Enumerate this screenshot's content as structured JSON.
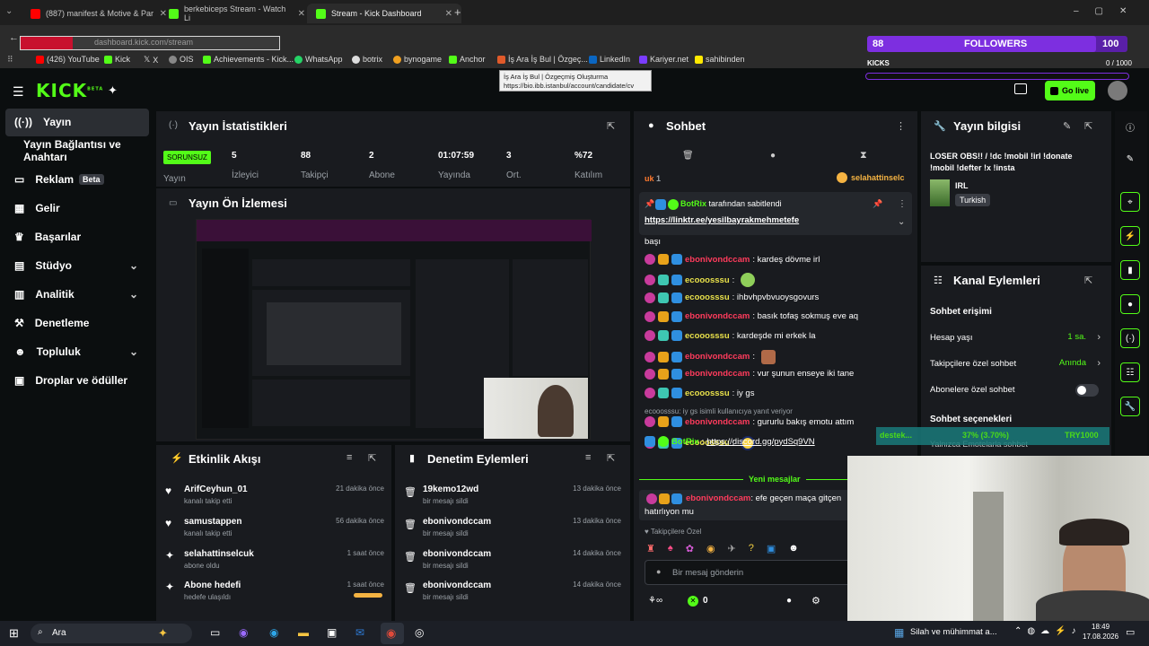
{
  "tabs": [
    {
      "label": "(887) manifest & Motive & Par",
      "icon": "youtube-icon",
      "color": "#ff0000"
    },
    {
      "label": "berkebiceps Stream - Watch Li",
      "icon": "kick-icon",
      "color": "#53fc18"
    },
    {
      "label": "Stream - Kick Dashboard",
      "icon": "kick-icon",
      "color": "#53fc18"
    }
  ],
  "new_tab": "+",
  "address": "dashboard.kick.com/stream",
  "bookmarks": [
    "(426) YouTube",
    "Kick",
    "X",
    "OIS",
    "Achievements - Kick...",
    "WhatsApp",
    "botrix",
    "bynogame",
    "Anchor",
    "İş Ara İş Bul | Özgeç...",
    "LinkedIn",
    "Kariyer.net",
    "sahibinden"
  ],
  "tooltip": {
    "title": "İş Ara İş Bul | Özgeçmiş Oluşturma",
    "url": "https://bio.ibb.istanbul/account/candidate/cv"
  },
  "overlay": {
    "followers_count": "88",
    "followers_label": "FOLLOWERS",
    "goal": "100",
    "kicks_label": "KICKS",
    "kicks_value": "0 / 1000",
    "followers_progress": 0.88
  },
  "topbar": {
    "logo": "KICK",
    "logo_sup": "BETA",
    "golive": "Go live"
  },
  "sidebar": [
    {
      "label": "Yayın",
      "icon": "broadcast-icon",
      "active": true
    },
    {
      "label": "Yayın Bağlantısı ve Anahtarı",
      "icon": ""
    },
    {
      "label": "Reklam",
      "icon": "ad-icon",
      "badge": "Beta"
    },
    {
      "label": "Gelir",
      "icon": "revenue-icon"
    },
    {
      "label": "Başarılar",
      "icon": "trophy-icon"
    },
    {
      "label": "Stüdyo",
      "icon": "studio-icon",
      "chev": "⌄"
    },
    {
      "label": "Analitik",
      "icon": "analytics-icon",
      "chev": "⌄"
    },
    {
      "label": "Denetleme",
      "icon": "moderation-icon"
    },
    {
      "label": "Topluluk",
      "icon": "community-icon",
      "chev": "⌄"
    },
    {
      "label": "Droplar ve ödüller",
      "icon": "drops-icon"
    }
  ],
  "stats": {
    "title": "Yayın İstatistikleri",
    "status": "SORUNSUZ",
    "status_label": "Yayın",
    "items": [
      {
        "value": "5",
        "label": "İzleyici"
      },
      {
        "value": "88",
        "label": "Takipçi"
      },
      {
        "value": "2",
        "label": "Abone"
      },
      {
        "value": "01:07:59",
        "label": "Yayında"
      },
      {
        "value": "3",
        "label": "Ort."
      },
      {
        "value": "%72",
        "label": "Katılım"
      }
    ]
  },
  "preview": {
    "title": "Yayın Ön İzlemesi"
  },
  "activity": {
    "title": "Etkinlik Akışı",
    "items": [
      {
        "name": "ArifCeyhun_01",
        "sub": "kanalı takip etti",
        "time": "21 dakika önce",
        "icon": "heart-icon"
      },
      {
        "name": "samustappen",
        "sub": "kanalı takip etti",
        "time": "56 dakika önce",
        "icon": "heart-icon"
      },
      {
        "name": "selahattinselcuk",
        "sub": "abone oldu",
        "time": "1 saat önce",
        "icon": "star-icon"
      },
      {
        "name": "Abone hedefi",
        "sub": "hedefe ulaşıldı",
        "time": "1 saat önce",
        "icon": "star-icon"
      }
    ]
  },
  "moderation": {
    "title": "Denetim Eylemleri",
    "items": [
      {
        "name": "19kemo12wd",
        "sub": "bir mesajı sildi",
        "time": "13 dakika önce"
      },
      {
        "name": "ebonivondccam",
        "sub": "bir mesajı sildi",
        "time": "13 dakika önce"
      },
      {
        "name": "ebonivondccam",
        "sub": "bir mesajı sildi",
        "time": "14 dakika önce"
      },
      {
        "name": "ebonivondccam",
        "sub": "bir mesajı sildi",
        "time": "14 dakika önce"
      }
    ]
  },
  "chat": {
    "title": "Sohbet",
    "sub_prefix": "uk",
    "sub_count": "1",
    "sub_user": "selahattinselc",
    "pinned_by": "BotRix",
    "pinned_text": "tarafından sabitlendi",
    "pinned_link": "https://linktr.ee/yesilbayrakmehmetefe",
    "partial": "başı",
    "messages": [
      {
        "user": "ebonivondccam",
        "text": ": kardeş dövme irl",
        "color": "#ff3b5c",
        "badges": [
          "bp",
          "bo",
          "bb"
        ]
      },
      {
        "user": "ecooosssu",
        "text": ":",
        "color": "#e8e04a",
        "badges": [
          "bp",
          "bg",
          "bb"
        ],
        "emote": "turtle-emote"
      },
      {
        "user": "ecooosssu",
        "text": ": ihbvhpvbvuoysgovurs",
        "color": "#e8e04a",
        "badges": [
          "bp",
          "bg",
          "bb"
        ]
      },
      {
        "user": "ebonivondccam",
        "text": ": basık tofaş sokmuş eve aq",
        "color": "#ff3b5c",
        "badges": [
          "bp",
          "bo",
          "bb"
        ]
      },
      {
        "user": "ecooosssu",
        "text": ": kardeşde mi erkek la",
        "color": "#e8e04a",
        "badges": [
          "bp",
          "bg",
          "bb"
        ]
      },
      {
        "user": "ebonivondccam",
        "text": ":",
        "color": "#ff3b5c",
        "badges": [
          "bp",
          "bo",
          "bb"
        ],
        "emote": "face-emote"
      },
      {
        "user": "ebonivondccam",
        "text": ": vur şunun enseye iki tane",
        "color": "#ff3b5c",
        "badges": [
          "bp",
          "bo",
          "bb"
        ]
      },
      {
        "user": "ecooosssu",
        "text": ": iy gs",
        "color": "#e8e04a",
        "badges": [
          "bp",
          "bg",
          "bb"
        ]
      }
    ],
    "reply_hint": "ecooosssu: iy gs isimli kullanıcıya yanıt veriyor",
    "messages2": [
      {
        "user": "ebonivondccam",
        "text": ": gururlu bakış emotu attım",
        "color": "#ff3b5c",
        "badges": [
          "bp",
          "bo",
          "bb"
        ]
      },
      {
        "user": "ecooosssu",
        "text": ":",
        "color": "#e8e04a",
        "badges": [
          "bp",
          "bg",
          "bb"
        ],
        "emote": "fb-emote"
      }
    ],
    "botrix_user": "BotRix",
    "botrix_link": "https://discord.gg/pydSq9VN",
    "new_messages": "Yeni mesajlar",
    "last_user": "ebonivondccam",
    "last_text": ": efe geçen maça gitçen",
    "last_text2": "hatırlıyon mu",
    "followers_only": "Takipçilere Özel",
    "input_placeholder": "Bir mesaj gönderin",
    "kicks_count": "0"
  },
  "info": {
    "title": "Yayın bilgisi",
    "stream_title": "LOSER OBS!! / !dc !mobil !irl !donate !mobil !defter !x !insta",
    "category": "IRL",
    "language": "Turkish"
  },
  "actions": {
    "title": "Kanal Eylemleri",
    "section": "Sohbet erişimi",
    "rows": [
      {
        "label": "Hesap yaşı",
        "value": "1 sa.",
        "kind": "link"
      },
      {
        "label": "Takipçilere özel sohbet",
        "value": "Anında",
        "kind": "link"
      },
      {
        "label": "Abonelere özel sohbet",
        "value": "",
        "kind": "toggle"
      }
    ],
    "section2": "Sohbet seçenekleri",
    "row4": "Yalnızca Emotelarla sohbet"
  },
  "donation": {
    "user": "destek...",
    "pct": "37% (3.70%)",
    "goal": "TRY1000"
  },
  "taskbar": {
    "search": "Ara",
    "weather": "Silah ve mühimmat a...",
    "time": "18:49",
    "date": "17.08.2026"
  }
}
